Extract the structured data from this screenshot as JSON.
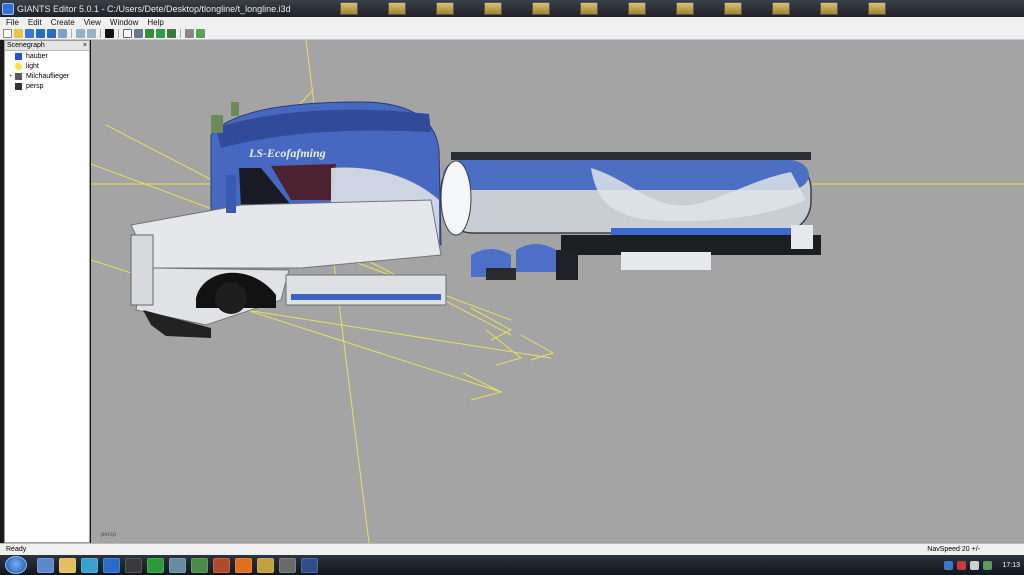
{
  "window": {
    "title": "GIANTS Editor 5.0.1 - C:/Users/Dete/Desktop/tlongline/t_longline.i3d"
  },
  "menu": {
    "items": [
      "File",
      "Edit",
      "Create",
      "View",
      "Window",
      "Help"
    ]
  },
  "scenegraph": {
    "title": "Scenegraph",
    "close": "×",
    "items": [
      {
        "label": "hauber",
        "icon": "cube-icon"
      },
      {
        "label": "light",
        "icon": "bulb-icon"
      },
      {
        "label": "Milchauflieger",
        "icon": "group-icon"
      },
      {
        "label": "persp",
        "icon": "camera-icon"
      }
    ]
  },
  "viewport": {
    "camera_label": "persp",
    "truck_decal_text": "LS-Ecofafming",
    "background_color": "#a4a4a4"
  },
  "status": {
    "left": "Ready",
    "right": "NavSpeed 20 +/-"
  },
  "taskbar": {
    "time": "17:13"
  },
  "colors": {
    "accent_blue": "#4a6ec2",
    "gizmo_yellow": "#e8e060"
  }
}
